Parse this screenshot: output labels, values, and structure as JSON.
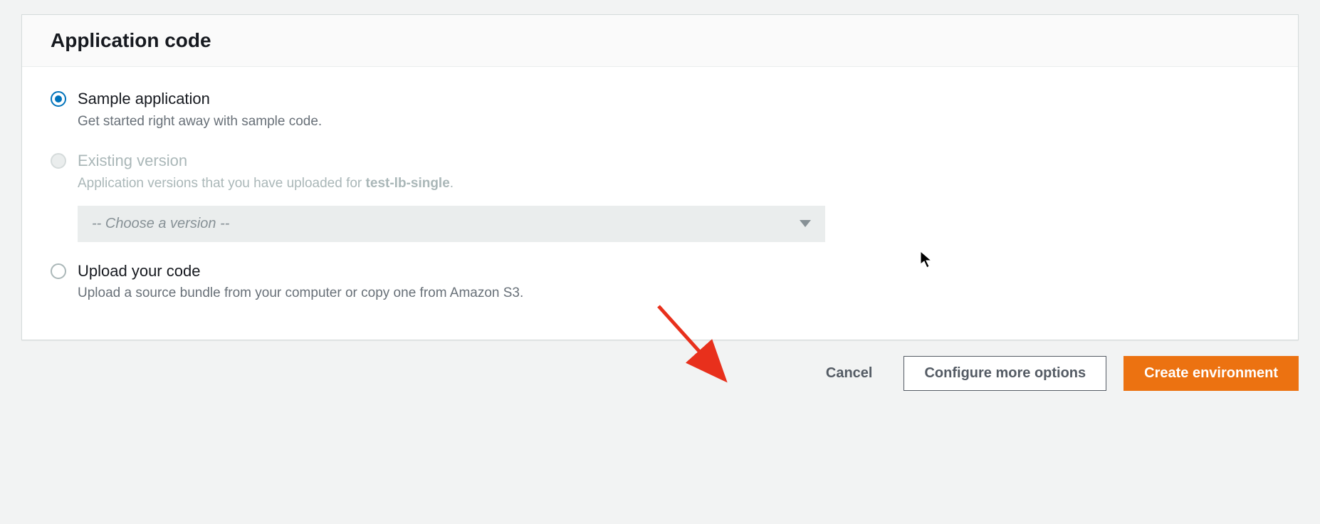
{
  "panel": {
    "title": "Application code"
  },
  "options": {
    "sample": {
      "title": "Sample application",
      "desc": "Get started right away with sample code."
    },
    "existing": {
      "title": "Existing version",
      "desc_prefix": "Application versions that you have uploaded for ",
      "desc_bold": "test-lb-single",
      "desc_suffix": ".",
      "select_placeholder": "-- Choose a version --"
    },
    "upload": {
      "title": "Upload your code",
      "desc": "Upload a source bundle from your computer or copy one from Amazon S3."
    }
  },
  "buttons": {
    "cancel": "Cancel",
    "configure": "Configure more options",
    "create": "Create environment"
  }
}
